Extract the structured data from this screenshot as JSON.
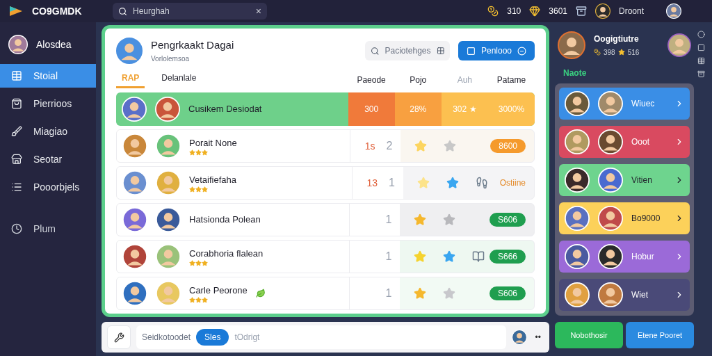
{
  "topbar": {
    "logo": "CO9GMDK",
    "search": {
      "value": "Heurghah",
      "clear": "×"
    },
    "coins": "310",
    "gems": "3601",
    "user": "Droont"
  },
  "sidebar": {
    "profile": "Alosdea",
    "items": [
      {
        "label": "Stoial",
        "selected": true
      },
      {
        "label": "Pierrioos",
        "selected": false
      },
      {
        "label": "Miagiao",
        "selected": false
      },
      {
        "label": "Seotar",
        "selected": false
      },
      {
        "label": "Pooorbjels",
        "selected": false
      }
    ],
    "footer": {
      "label": "Plum"
    }
  },
  "card": {
    "title": "Pengrkaakt Dagai",
    "subtitle": "Vorlolemsoa",
    "search_placeholder": "Paciotehges",
    "button": "Penlooo",
    "tabs": [
      {
        "label": "RAP",
        "selected": true
      },
      {
        "label": "Delanlale",
        "selected": false
      }
    ],
    "columns": [
      "Paeode",
      "Pojo",
      "Auh",
      "Patame"
    ],
    "rows": [
      {
        "kind": "highlight",
        "name": "Cusikem Desiodat",
        "cells": [
          "300",
          "28%",
          "302 ★",
          "3000%"
        ]
      },
      {
        "kind": "entry",
        "name": "Porait None",
        "stars": 3,
        "num_a": "1s",
        "num_b": "2",
        "marks": [
          {
            "color": "#fcd560"
          },
          {
            "color": "#c8c8c8"
          }
        ],
        "status": {
          "text": "8600",
          "color": "#f59a2c",
          "kind": "badge"
        }
      },
      {
        "kind": "entry",
        "name": "Vetaifiefaha",
        "stars": 3,
        "num_a": "13",
        "num_b": "1",
        "marks": [
          {
            "color": "#fce38a"
          },
          {
            "color": "#3aa6f0"
          }
        ],
        "status": {
          "text": "Ostiine",
          "color": "#e48b2a",
          "kind": "text"
        }
      },
      {
        "kind": "entry",
        "name": "Hatsionda Polean",
        "num_b": "1",
        "marks": [
          {
            "color": "#f5b82e"
          },
          {
            "color": "#b8b8bc"
          }
        ],
        "status": {
          "text": "S606",
          "color": "#1f9e4f",
          "kind": "badge"
        }
      },
      {
        "kind": "entry",
        "name": "Corabhoria flalean",
        "stars": 3,
        "num_b": "1",
        "marks": [
          {
            "color": "#f5d32e"
          },
          {
            "color": "#3aa6f0"
          }
        ],
        "status": {
          "text": "S666",
          "color": "#1f9e4f",
          "kind": "badge"
        }
      },
      {
        "kind": "entry",
        "name": "Carle Peorone",
        "stars": 3,
        "num_b": "1",
        "marks": [
          {
            "color": "#f5b82e"
          },
          {
            "color": "#c8c8cc"
          }
        ],
        "status": {
          "text": "S606",
          "color": "#1f9e4f",
          "kind": "badge"
        }
      }
    ]
  },
  "bottombar": {
    "label": "Seidkotoodet",
    "chip": "Sles",
    "text": "tOdrigt",
    "more": "••"
  },
  "panel": {
    "name": "Oogigtiutre",
    "coins": "398",
    "stars": "516",
    "heading": "Naote",
    "items": [
      {
        "label": "Wiuec",
        "color": "#3a8ee6"
      },
      {
        "label": "Ooot",
        "color": "#d94a60"
      },
      {
        "label": "Vitien",
        "color": "#6ed48e"
      },
      {
        "label": "Bo9000",
        "color": "#fcd15a"
      },
      {
        "label": "Hobur",
        "color": "#9b6ad8"
      },
      {
        "label": "Wiet",
        "color": "#4a4a78"
      }
    ],
    "buttons": [
      {
        "label": "Nobothosir",
        "kind": "primary"
      },
      {
        "label": "Etene Pooret",
        "kind": "secondary"
      }
    ]
  }
}
